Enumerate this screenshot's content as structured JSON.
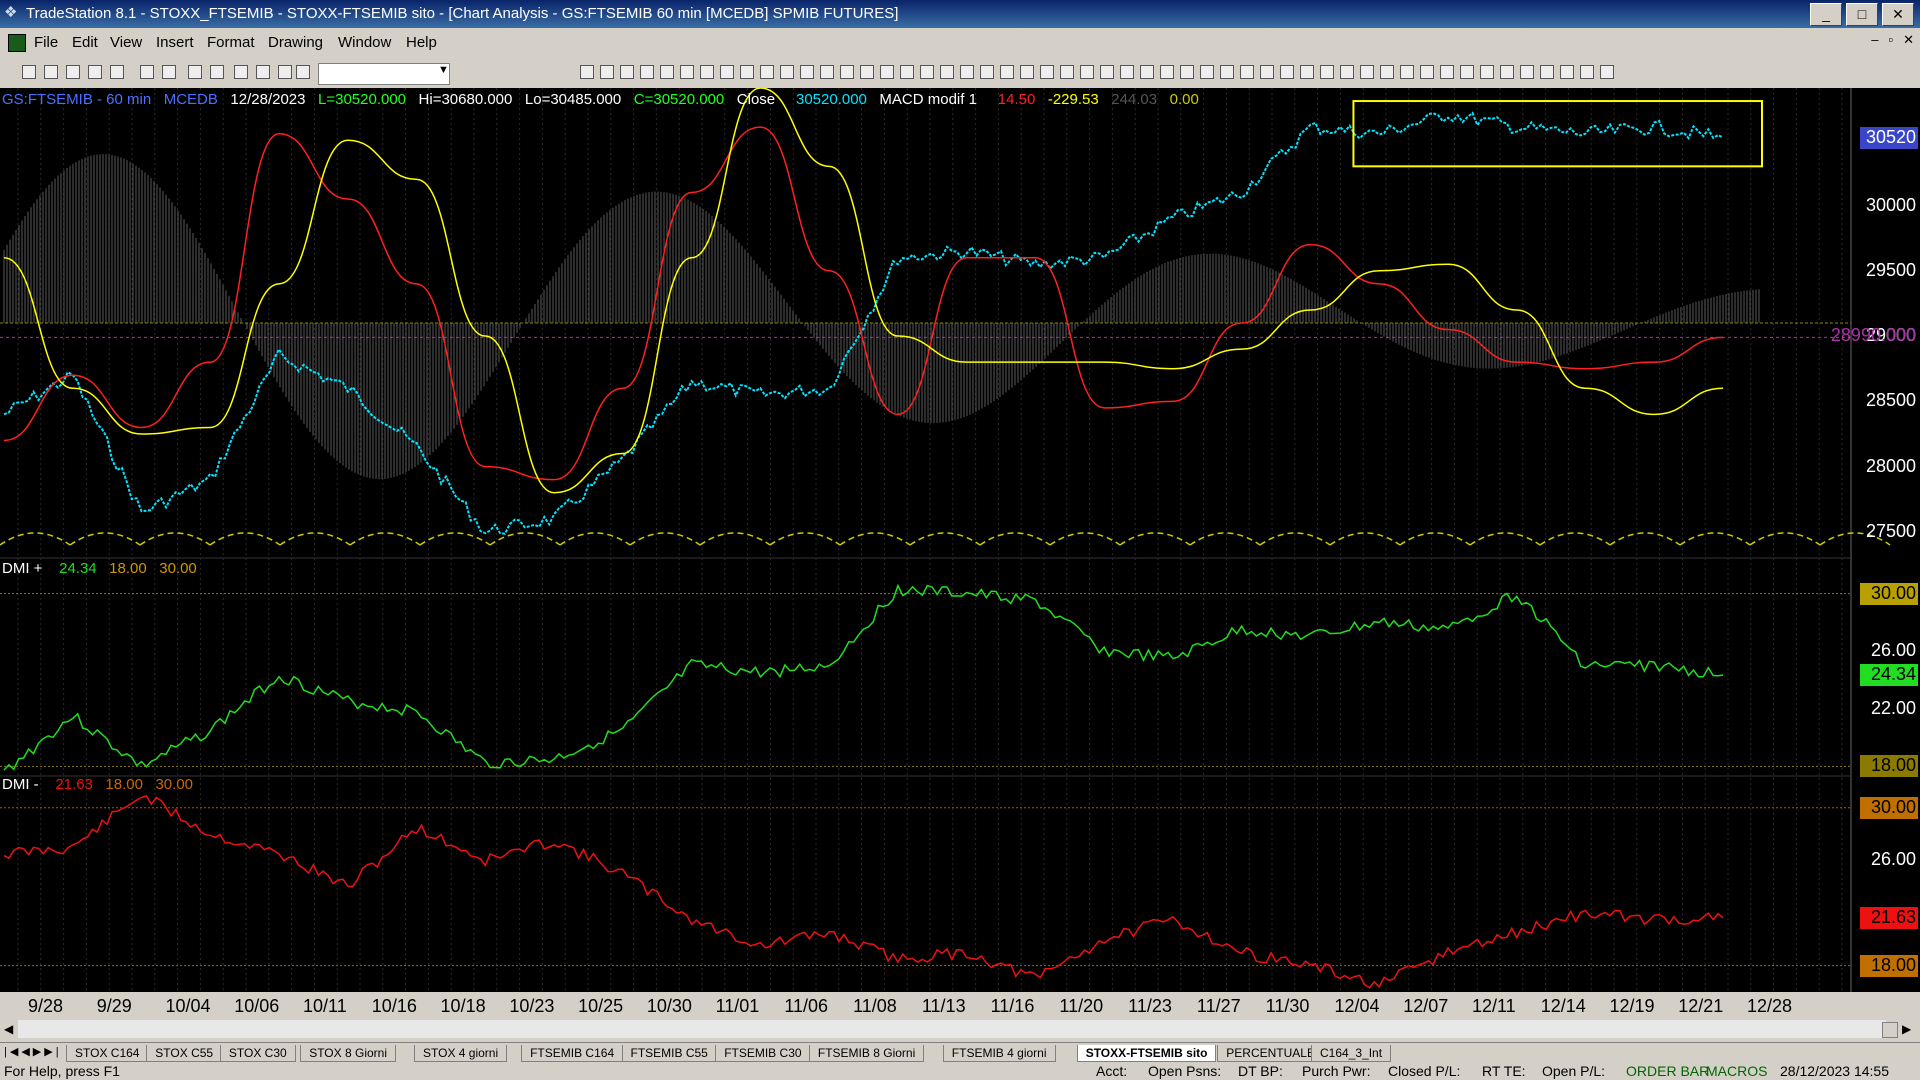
{
  "window": {
    "title": "TradeStation 8.1 - STOXX_FTSEMIB - STOXX-FTSEMIB sito - [Chart Analysis - GS:FTSEMIB  60 min  [MCEDB] SPMIB FUTURES]"
  },
  "menu": [
    "File",
    "Edit",
    "View",
    "Insert",
    "Format",
    "Drawing",
    "Window",
    "Help"
  ],
  "price_header": {
    "symbol": "GS:FTSEMIB - 60 min",
    "study": "MCEDB",
    "date": "12/28/2023",
    "last": "L=30520.000",
    "high": "Hi=30680.000",
    "low": "Lo=30485.000",
    "close": "C=30520.000",
    "close_label": "Close",
    "close_value": "30520.000",
    "macd_label": "MACD modif 1",
    "macd_v1": "14.50",
    "macd_v2": "-229.53",
    "macd_v3": "244.03",
    "macd_v4": "0.00"
  },
  "dmi_plus_header": {
    "label": "DMI +",
    "v1": "24.34",
    "v2": "18.00",
    "v3": "30.00"
  },
  "dmi_minus_header": {
    "label": "DMI -",
    "v1": "21.63",
    "v2": "18.00",
    "v3": "30.00"
  },
  "price_axis": {
    "current": "30520",
    "labels": [
      "30000",
      "29500",
      "29000",
      "28500",
      "28000",
      "27500"
    ],
    "ref_label": "28990.000"
  },
  "dmi_plus_axis": {
    "labels": [
      "30.00",
      "26.00",
      "24.34",
      "22.00",
      "18.00"
    ]
  },
  "dmi_minus_axis": {
    "labels": [
      "30.00",
      "26.00",
      "21.63",
      "18.00"
    ]
  },
  "date_axis": [
    "9/28",
    "9/29",
    "10/04",
    "10/06",
    "10/11",
    "10/16",
    "10/18",
    "10/23",
    "10/25",
    "10/30",
    "11/01",
    "11/06",
    "11/08",
    "11/13",
    "11/16",
    "11/20",
    "11/23",
    "11/27",
    "11/30",
    "12/04",
    "12/07",
    "12/11",
    "12/14",
    "12/19",
    "12/21",
    "12/28"
  ],
  "tabs": [
    "STOX C164",
    "STOX C55",
    "STOX  C30",
    "STOX  8 Giorni",
    "STOX 4 giorni",
    "FTSEMIB C164",
    "FTSEMIB C55",
    "FTSEMIB C30",
    "FTSEMIB  8 Giorni",
    "FTSEMIB  4 giorni",
    "STOXX-FTSEMIB sito",
    "PERCENTUALE",
    "C164_3_Int"
  ],
  "active_tab": "STOXX-FTSEMIB sito",
  "status": {
    "help": "For Help, press F1",
    "acct": "Acct:",
    "open_psns": "Open Psns:",
    "dt_bp": "DT BP:",
    "purch_pwr": "Purch Pwr:",
    "closed_pl": "Closed P/L:",
    "rt_te": "RT TE:",
    "open_pl": "Open P/L:",
    "order_bar": "ORDER BAR",
    "macros": "MACROS",
    "datetime": "28/12/2023 14:55"
  },
  "chart_data": [
    {
      "type": "line",
      "name": "price panel",
      "x": [
        "9/28",
        "9/29",
        "10/04",
        "10/06",
        "10/11",
        "10/16",
        "10/18",
        "10/23",
        "10/25",
        "10/30",
        "11/01",
        "11/06",
        "11/08",
        "11/13",
        "11/16",
        "11/20",
        "11/23",
        "11/27",
        "11/30",
        "12/04",
        "12/07",
        "12/11",
        "12/14",
        "12/19",
        "12/21",
        "12/28"
      ],
      "ylim": [
        27300,
        30900
      ],
      "series": [
        {
          "color": "#00e5ff",
          "values": [
            28400,
            28700,
            27650,
            27900,
            28850,
            28600,
            28150,
            27500,
            27600,
            28050,
            28650,
            28550,
            28600,
            29600,
            29650,
            29550,
            29600,
            29900,
            30100,
            30600,
            30550,
            30700,
            30600,
            30550,
            30600,
            30520
          ]
        },
        {
          "color": "#ff2020",
          "values": [
            28200,
            28700,
            28300,
            28800,
            30550,
            30050,
            29400,
            28000,
            27900,
            28600,
            30100,
            30600,
            29500,
            28400,
            29600,
            29600,
            28450,
            28500,
            29100,
            29700,
            29400,
            29050,
            28800,
            28750,
            28800,
            28990
          ]
        },
        {
          "color": "#ffff00",
          "values": [
            29600,
            28600,
            28250,
            28300,
            29400,
            30500,
            30200,
            29000,
            27800,
            28100,
            29600,
            30900,
            30300,
            29000,
            28800,
            28800,
            28800,
            28750,
            28900,
            29200,
            29500,
            29550,
            29200,
            28600,
            28400,
            28600
          ]
        }
      ],
      "reference_line": 28990,
      "highlight_box": {
        "x_from": "12/04",
        "x_to": "12/28",
        "y_from": 30300,
        "y_to": 30800
      }
    },
    {
      "type": "line",
      "name": "DMI +",
      "x": [
        "9/28",
        "9/29",
        "10/04",
        "10/06",
        "10/11",
        "10/16",
        "10/18",
        "10/23",
        "10/25",
        "10/30",
        "11/01",
        "11/06",
        "11/08",
        "11/13",
        "11/16",
        "11/20",
        "11/23",
        "11/27",
        "11/30",
        "12/04",
        "12/07",
        "12/11",
        "12/14",
        "12/19",
        "12/21",
        "12/28"
      ],
      "ylim": [
        16.5,
        31.5
      ],
      "series": [
        {
          "color": "#22dd22",
          "values": [
            17.6,
            21.5,
            18.0,
            20.5,
            24.3,
            22.5,
            21.8,
            18.2,
            18.5,
            20.5,
            25.0,
            24.5,
            25.0,
            30.3,
            30.0,
            29.5,
            26.0,
            25.5,
            27.5,
            27.0,
            28.0,
            27.5,
            30.0,
            25.0,
            25.0,
            24.34
          ]
        }
      ],
      "levels": [
        18.0,
        30.0
      ]
    },
    {
      "type": "line",
      "name": "DMI -",
      "x": [
        "9/28",
        "9/29",
        "10/04",
        "10/06",
        "10/11",
        "10/16",
        "10/18",
        "10/23",
        "10/25",
        "10/30",
        "11/01",
        "11/06",
        "11/08",
        "11/13",
        "11/16",
        "11/20",
        "11/23",
        "11/27",
        "11/30",
        "12/04",
        "12/07",
        "12/11",
        "12/14",
        "12/19",
        "12/21",
        "12/28"
      ],
      "ylim": [
        16.0,
        31.5
      ],
      "series": [
        {
          "color": "#ee1111",
          "values": [
            26.5,
            27.0,
            31.0,
            28.0,
            26.5,
            24.0,
            28.5,
            26.0,
            27.5,
            25.0,
            21.5,
            19.5,
            20.5,
            18.5,
            19.0,
            17.0,
            20.0,
            21.5,
            19.0,
            18.0,
            16.5,
            19.0,
            20.5,
            22.0,
            21.5,
            21.63
          ]
        }
      ],
      "levels": [
        18.0,
        30.0
      ]
    }
  ]
}
